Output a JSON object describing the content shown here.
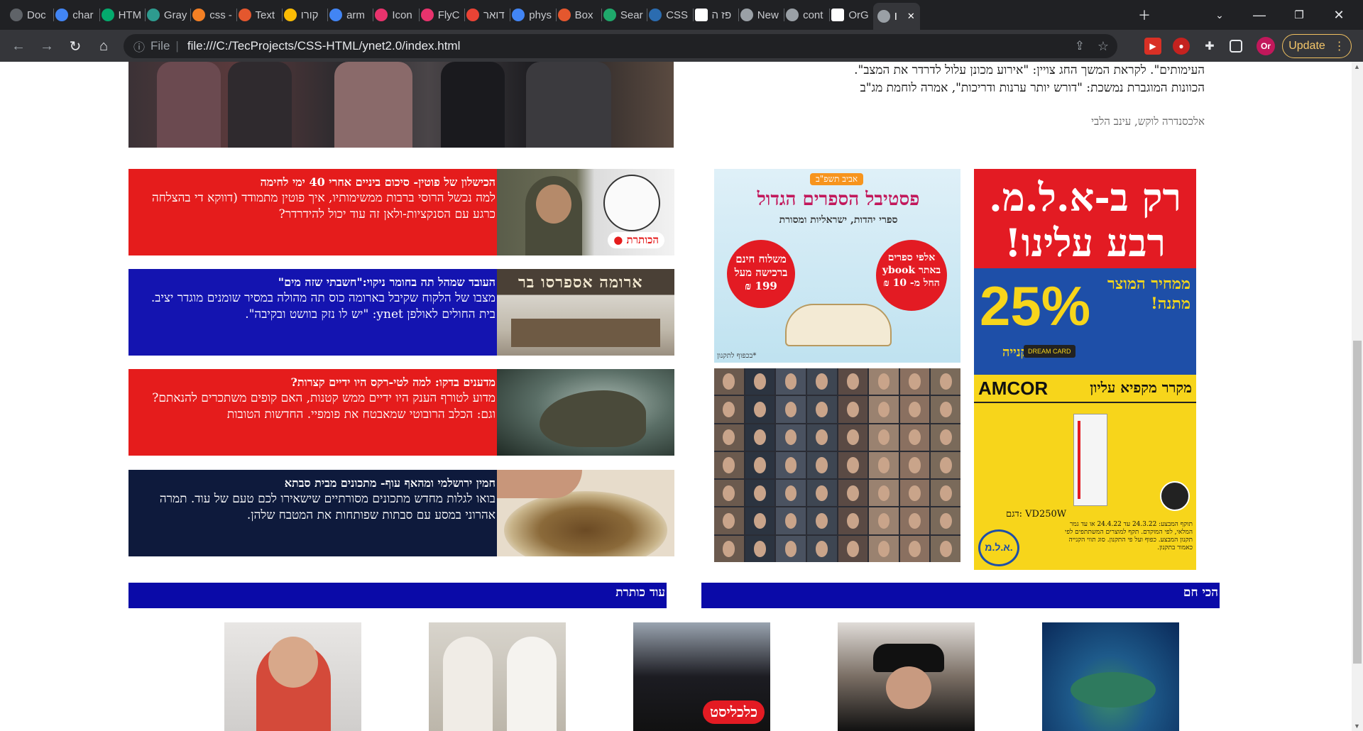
{
  "browser": {
    "tabs": [
      {
        "label": "Doc",
        "icon": "globe-icon",
        "color": "#5f6368"
      },
      {
        "label": "char",
        "icon": "google-icon",
        "color": "#4285f4"
      },
      {
        "label": "HTM",
        "icon": "w3-icon",
        "color": "#04aa6d"
      },
      {
        "label": "Gray",
        "icon": "d-icon",
        "color": "#2e9b8f"
      },
      {
        "label": "css -",
        "icon": "stack-icon",
        "color": "#f48024"
      },
      {
        "label": "Text",
        "icon": "box-icon",
        "color": "#e4572e"
      },
      {
        "label": "קורו",
        "icon": "drive-icon",
        "color": "#fbbc04"
      },
      {
        "label": "arm",
        "icon": "google-icon",
        "color": "#4285f4"
      },
      {
        "label": "Icon",
        "icon": "bird-icon",
        "color": "#e8336d"
      },
      {
        "label": "FlyC",
        "icon": "bird-icon",
        "color": "#e8336d"
      },
      {
        "label": "דואר",
        "icon": "gmail-icon",
        "color": "#ea4335"
      },
      {
        "label": "phys",
        "icon": "google-icon",
        "color": "#4285f4"
      },
      {
        "label": "Box",
        "icon": "box-icon",
        "color": "#e4572e"
      },
      {
        "label": "Sear",
        "icon": "v-icon",
        "color": "#1fa96b"
      },
      {
        "label": "CSS",
        "icon": "circle-icon",
        "color": "#2b6cb0"
      },
      {
        "label": "פז ה",
        "icon": "wiki-icon",
        "color": "#ffffff"
      },
      {
        "label": "New",
        "icon": "chrome-icon",
        "color": "#9aa0a6"
      },
      {
        "label": "cont",
        "icon": "globe-icon",
        "color": "#9aa0a6"
      },
      {
        "label": "OrG",
        "icon": "github-icon",
        "color": "#ffffff"
      },
      {
        "label": "I",
        "icon": "globe-icon",
        "color": "#9aa0a6"
      }
    ],
    "url_scheme": "File",
    "url": "file:///C:/TecProjects/CSS-HTML/ynet2.0/index.html",
    "update_label": "Update",
    "profile_initials": "Or"
  },
  "article": {
    "lead_line1": "העימותים\". לקראת המשך החג צויין: \"אירוע מכונן עלול לדרדר את המצב\".",
    "lead_line2": "הכוונות המוגברת נמשכת: \"דורש יותר ערנות ודריכות\", אמרה לוחמת מג\"ב",
    "byline": "אלכסנדרה לוקש, עינב הלבי"
  },
  "cards": [
    {
      "title": "הכישלון של פוטין- סיכום ביניים אחרי 40 ימי לחימה",
      "body": "למה נכשל הרוסי ברבות ממשימותיו, איך פוטין מתמודד (דווקא די בהצלחה כרגע עם הסנקציות-ולאן זה עוד יכול להידרדר?",
      "color": "#e51c1c",
      "badge": "הכותרת"
    },
    {
      "title": "העובד שמהל תה בחומר ניקוי:\"חשבתי שזה מים\"",
      "body": "מצבו של הלקוח שקיבל בארומה כוס תה מהולה במסיר שומנים מוגדר יציב. בית החולים לאולפן ynet: \"יש לו נזק בוושט ובקיבה\".",
      "color": "#1414b0",
      "badge": "ארומה אספרסו בר"
    },
    {
      "title": "מדענים בדקו: למה לטי-רקס היו ידיים קצרות?",
      "body": "מדוע לטורף הענק היו ידיים ממש קטנות, האם קופים משתכרים להנאתם? וגם: הכלב הרובוטי שמאבטח את פומפיי. החדשות הטובות",
      "color": "#e51c1c",
      "badge": ""
    },
    {
      "title": "חמין ירושלמי ומהאף עוף- מתכונים מבית סבתא",
      "body": "בואו לגלות מחדש מתכונים מסורתיים שישאירו לכם טעם של עוד. תמרה אהרוני במסע עם סבתות שפותחות את המטבח שלהן.",
      "color": "#0e1a3c",
      "badge": ""
    }
  ],
  "ads": {
    "book_festival": {
      "top": "אביב תשפ\"ב",
      "title": "פסטיבל הספרים הגדול",
      "subtitle": "ספרי יהדות, ישראליות ומסורת",
      "left_circle": "משלוח חינם ברכישה מעל 199 ₪",
      "right_circle": "אלפי ספרים באתר ybook החל מ- 10 ₪",
      "footer": "*בכפוף לתקנון"
    },
    "alam": {
      "headline": "רק ב-א.ל.מ. רבע עלינו!",
      "discount": "25%",
      "discount_text": "ממחיר המוצר מתנה!",
      "sub": "בתווי קנייה",
      "card_label": "DREAM CARD",
      "brand": "AMCOR",
      "product": "מקרר מקפיא עליון",
      "model": "VD250W :דגם",
      "fine_print": "תוקף המבצע: 24.3.22 עד 24.4.22 או עד גמר המלאי, לפי המוקדם. תקף למוצרים המשתתפים לפי תקנון המבצע. כפוף ועל פי התקנון. סוג תווי הקנייה כאמור בתקנון.",
      "logo": "א.ל.מ."
    }
  },
  "sections": {
    "more_headlines": "עוד כותרת",
    "hottest": "הכי חם"
  },
  "bottom_badge": "כלכליסט",
  "colors": {
    "red": "#e51c1c",
    "blue": "#1414b0",
    "navy": "#0e1a3c",
    "section_blue": "#0a0aa8",
    "ad_yellow": "#f7d51b",
    "ad_red": "#e31b23",
    "ad_blue": "#1e4fa8"
  }
}
